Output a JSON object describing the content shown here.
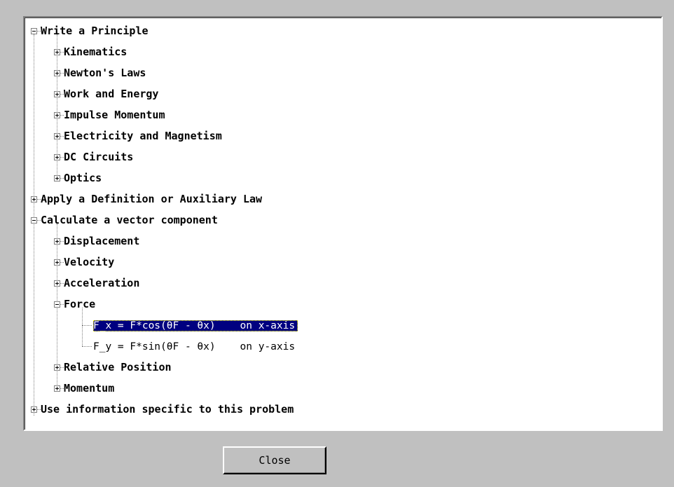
{
  "tree": {
    "items": [
      {
        "label": "Write a Principle",
        "depth": 0,
        "state": "expanded"
      },
      {
        "label": "Kinematics",
        "depth": 1,
        "state": "collapsed"
      },
      {
        "label": "Newton's Laws",
        "depth": 1,
        "state": "collapsed"
      },
      {
        "label": "Work and Energy",
        "depth": 1,
        "state": "collapsed"
      },
      {
        "label": "Impulse Momentum",
        "depth": 1,
        "state": "collapsed"
      },
      {
        "label": "Electricity and Magnetism",
        "depth": 1,
        "state": "collapsed"
      },
      {
        "label": "DC Circuits",
        "depth": 1,
        "state": "collapsed"
      },
      {
        "label": "Optics",
        "depth": 1,
        "state": "collapsed"
      },
      {
        "label": "Apply a Definition or Auxiliary Law",
        "depth": 0,
        "state": "collapsed"
      },
      {
        "label": "Calculate a vector component",
        "depth": 0,
        "state": "expanded"
      },
      {
        "label": "Displacement",
        "depth": 1,
        "state": "collapsed"
      },
      {
        "label": "Velocity",
        "depth": 1,
        "state": "collapsed"
      },
      {
        "label": "Acceleration",
        "depth": 1,
        "state": "collapsed"
      },
      {
        "label": "Force",
        "depth": 1,
        "state": "expanded"
      },
      {
        "label": "F_x = F*cos(θF - θx)    on x-axis",
        "depth": 2,
        "state": "leaf",
        "selected": true
      },
      {
        "label": "F_y = F*sin(θF - θx)    on y-axis",
        "depth": 2,
        "state": "leaf"
      },
      {
        "label": "Relative Position",
        "depth": 1,
        "state": "collapsed"
      },
      {
        "label": "Momentum",
        "depth": 1,
        "state": "collapsed"
      },
      {
        "label": "Use information specific to this problem",
        "depth": 0,
        "state": "collapsed"
      }
    ]
  },
  "buttons": {
    "close_label": "Close"
  },
  "colors": {
    "dialog_background": "#c0c0c0",
    "tree_background": "#ffffff",
    "selection_background": "#000080",
    "selection_text": "#ffffff"
  }
}
